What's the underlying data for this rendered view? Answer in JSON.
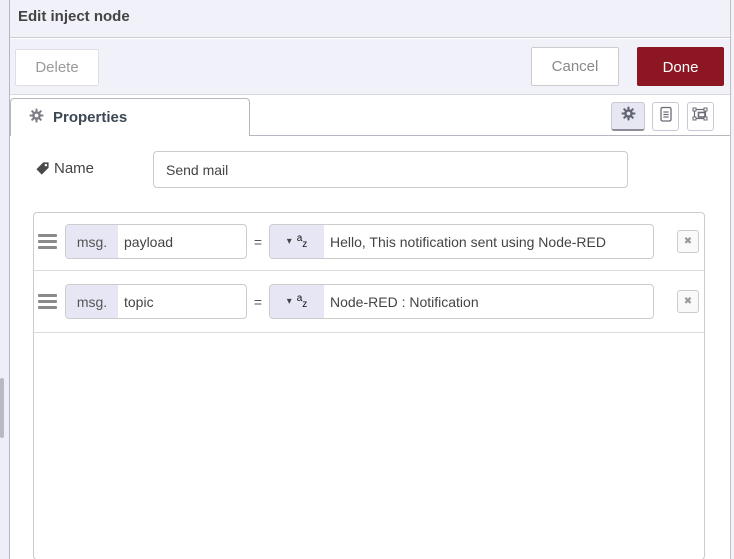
{
  "window": {
    "title": "Edit inject node"
  },
  "toolbar": {
    "delete_label": "Delete",
    "cancel_label": "Cancel",
    "done_label": "Done"
  },
  "tabs": {
    "properties_label": "Properties"
  },
  "form": {
    "name_label": "Name",
    "name_value": "Send mail",
    "rows": [
      {
        "prefix": "msg.",
        "property": "payload",
        "operator": "=",
        "type": "string",
        "value": "Hello, This notification sent using Node-RED"
      },
      {
        "prefix": "msg.",
        "property": "topic",
        "operator": "=",
        "type": "string",
        "value": "Node-RED : Notification"
      }
    ]
  },
  "icons": {
    "caret": "▾",
    "remove": "✖",
    "az_a": "a",
    "az_z": "z"
  },
  "colors": {
    "done_bg": "#8C1622",
    "lavender_accent": "#e6e6f5",
    "header_bg": "#f1f1f9",
    "border": "#cccccc"
  }
}
